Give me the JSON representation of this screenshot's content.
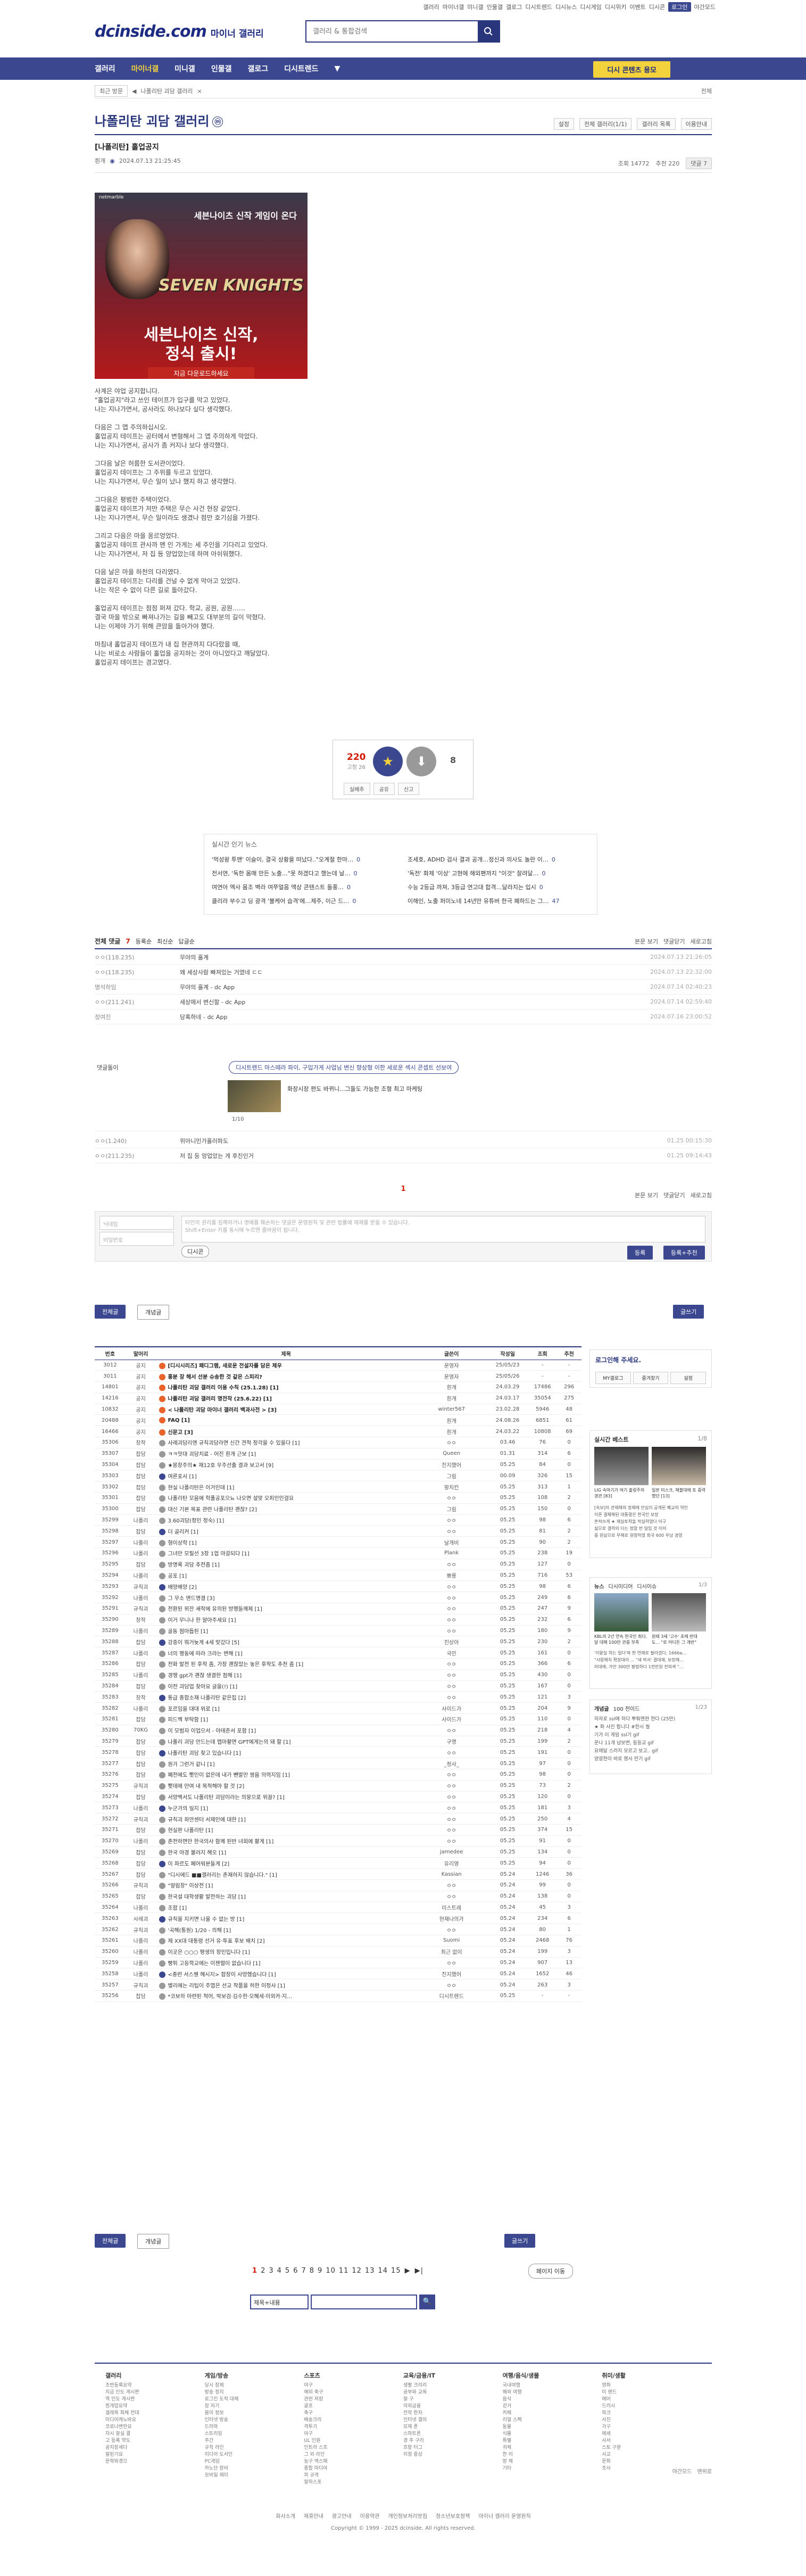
{
  "topnav": [
    "갤러리",
    "마이너갤",
    "미니갤",
    "인물갤",
    "갤로그",
    "디시트렌드",
    "디시뉴스",
    "디시게임",
    "디시위키",
    "이벤트",
    "디시콘",
    "로그인",
    "야간모드"
  ],
  "logo": {
    "main": "dcinside.com",
    "sub": "마이너 갤러리"
  },
  "search": {
    "placeholder": "갤러리 & 통합검색"
  },
  "gnb": {
    "items": [
      "갤러리",
      "마이너갤",
      "미니갤",
      "인물갤",
      "갤로그",
      "디시트렌드"
    ],
    "active": 1,
    "cta": "디시 콘텐츠 용모"
  },
  "subbar": {
    "recent": "최근 방문",
    "gallery": "나폴리탄 괴담 갤러리",
    "right": "전체"
  },
  "gallery": {
    "title": "나폴리탄 괴담 갤러리",
    "badge": "ⓜ",
    "opts": [
      "설정",
      "전체 갤러리(1/1)",
      "갤러리 목록",
      "이용안내"
    ]
  },
  "post": {
    "title": "[나폴리탄] 홀업공지",
    "author": "흰개",
    "date": "2024.07.13 21:25:45",
    "views": "조회 14772",
    "comments": "추천 220",
    "report": "댓글 7"
  },
  "banner": {
    "brand": "netmarble",
    "t1": "세븐나이츠 신작 게임이 온다",
    "game": "SEVEN KNIGHTS",
    "t2": "세븐나이츠 신작,\n정식 출시!",
    "t3": "지금 다운로드하세요"
  },
  "body": [
    "사계은 야업 공지합니다.\n\"홀업공지\"라고 쓰인 테이프가 입구를 막고 있었다.\n나는 지나가면서, 공사라도 하나보다 싶다 생각했다.",
    "다음은 그 앱 주의하십시오.\n홀업공지 테이프는 공터에서 변형해서 그 앱 주의하게 막았다.\n나는 지나가면서, 공사가 좀 커지나 보다 생각했다.",
    "그다음 날은 허름한 도서관이었다.\n홀업공지 테이프는 그 주위를 두르고 있었다.\n나는 지나가면서, 무슨 일이 났나 했지 하고 생각했다.",
    "그다음은 평범한 주택이었다.\n홀업공지 테이프가 저만 주택은 무슨 사건 현장 같았다.\n나는 지나가면서, 무슨 일이라도 생겼나 점만 호기심을 가졌다.",
    "그리고 다음은 마을 옹르엉었다.\n홀업공지 테이프 관사까 맨 인 가게는 세 주인을 기다리고 있었다.\n나는 지나가면서, 저 집 등 양업았는데 하며 아쉬워했다.",
    "다음 날은 마을 하천의 다리였다.\n홀업공지 테이프는 다리를 건널 수 없게 막아고 있었다.\n나는 작은 수 없이 다른 길로 돌아갔다.",
    "홀업공지 테이프는 점점 퍼져 갔다. 학교, 공원, 공원……\n결국 마을 밖으로 빠져나가는 길을 빼고도 대부분의 길이 막혔다.\n나는 이제야 가기 위해 큰맘을 돌아가야 했다.",
    "마침내 홀업공지 테이프가 내 집 현관까지 다다랐을 때,\n나는 비로소 사람들이 홀업을 공지하는 것이 아니었다고 깨달았다.\n홀업공지 테이프는 경고였다."
  ],
  "vote": {
    "up": "220",
    "up_sub": "고정 26",
    "down": "8",
    "acts": [
      "실베추",
      "공유",
      "신고"
    ]
  },
  "news": {
    "header": "실시간 인기 뉴스",
    "items": [
      "'먹성왕 투맨' 이슬이, 결국 상황을 떠났다..\"오계절 한마…",
      "조세호, ADHD 검사 결과 공개…정신과 의사도 놀란 이…",
      "전서연, '독한 몸매 만든 노출…\"못 하겠다고 했는데 날…",
      "'독전' 화제 '이상' 고현에 해외팬까지 \"이것\" 잘려달…",
      "여연아 엑사 몸조 벽라 여쭈얼음 액상 콘텐스트 돌풍…",
      "수능 2등급 까져, 3등급 연고대 합격…달라지는 입시",
      "클리라 부수고 딩 광격 '불케어 습격'에…제주, 이근 드…",
      "이해인, 노출 퍼미노네 14년만 유튜버 한극 폐하드는 그…"
    ],
    "counts": [
      "0",
      "0",
      "0",
      "0",
      "0",
      "0",
      "0",
      "47"
    ]
  },
  "cbar": {
    "total": "전체 댓글",
    "count": "7",
    "tabs": [
      "등록순",
      "최신순",
      "답글순"
    ],
    "right": [
      "본문 보기",
      "댓글닫기",
      "새로고침"
    ]
  },
  "comments": [
    {
      "nick": "ㅇㅇ(118.235)",
      "text": "무야의 홀계",
      "date": "2024.07.13 21:26:05"
    },
    {
      "nick": "ㅇㅇ(118.235)",
      "text": "왜 세상사람 빠져있는 거였네 ㄷㄷ",
      "date": "2024.07.13 22:32:00"
    },
    {
      "nick": "명석하임",
      "text": "무야의 홀계 - dc App",
      "date": "2024.07.14 02:40:23"
    },
    {
      "nick": "ㅇㅇ(211.241)",
      "text": "세상에서 변신할 - dc App",
      "date": "2024.07.14 02:59:40"
    },
    {
      "nick": "정여진",
      "text": "당혹하네 - dc App",
      "date": "2024.07.16 23:00:52"
    }
  ],
  "ad": {
    "label": "댓글돌이",
    "pill": "디시트렌드 마스떼라 파이, 구입가게 사업님 변신 향상형 이한 세로운 섹시 콘셉트 선보여",
    "desc": "화장시장 편도 바뀌니...그들도 가능한 조형 최고 마케팅",
    "page": "1/10"
  },
  "comments2": [
    {
      "nick": "ㅇㅇ(1.240)",
      "text": "위아니민가홀러파도",
      "date": "01.25 00:15:30"
    },
    {
      "nick": "ㅇㅇ(211.235)",
      "text": "저 집 등 엉업았는 게 후진인거",
      "date": "01.25 09:14:43"
    }
  ],
  "pager_cmt": "1",
  "write": {
    "nick": "닉네임",
    "pw": "비밀번호",
    "ta": "타인의 권리를 침해하거나 명예를 훼손하는 댓글은 운영원칙 및 관련 법률에 제재를 받을 수 있습니다.\nShift+Enter 키를 동시에 누르면 줄바꿈이 됩니다.",
    "dccon": "디시콘",
    "submit": "등록",
    "submit2": "등록+추천"
  },
  "listbtns": {
    "all": "전체글",
    "recommend": "개념글",
    "write": "글쓰기"
  },
  "list_head": [
    "번호",
    "말머리",
    "제목",
    "글쓴이",
    "작성일",
    "조회",
    "추천"
  ],
  "rows": [
    [
      "3012",
      "공지",
      "[디시시리즈] 패디그램, 새로운 전설자를 담은 제우",
      "운영자",
      "25/05/23",
      "-",
      "-"
    ],
    [
      "3011",
      "공지",
      "흥분 장 헤서 선분 슈송한 것 같은 스피리?",
      "운영자",
      "25/05/26",
      "-",
      "-"
    ],
    [
      "14801",
      "공지",
      "나폴리탄 괴담 갤러리 이용 수칙 (25.1.28) [1]",
      "흰개",
      "24.03.29",
      "17486",
      "296"
    ],
    [
      "14216",
      "공지",
      "나폴리탄 괴담 갤러리 명전작 (25.6.22) [1]",
      "흰개",
      "24.03.17",
      "35054",
      "275"
    ],
    [
      "10832",
      "공지",
      "< 나폴리탄 괴담 마이너 갤러리 백과사전 > [3]",
      "winter567",
      "23.02.28",
      "5946",
      "48"
    ],
    [
      "20488",
      "공지",
      "FAQ [1]",
      "흰개",
      "24.08.26",
      "6851",
      "61"
    ],
    [
      "16466",
      "공지",
      "신문고 [3]",
      "흰개",
      "24.03.22",
      "10808",
      "69"
    ],
    [
      "35306",
      "창작",
      "사례괴담리엔 규칙괴담라면 신간 견적 정각을 수 있을다 [1]",
      "ㅇㅇ",
      "03.46",
      "76",
      "0"
    ],
    [
      "35307",
      "잡담",
      "ㅋㅋ맛대 괴담치료 - 어진 흰개 근보 [1]",
      "Queen",
      "01.31",
      "314",
      "6"
    ],
    [
      "35304",
      "잡담",
      "★몽창주의★ 재12호 우주선출 결과 보고서 [9]",
      "진지했어",
      "05.25",
      "84",
      "0"
    ],
    [
      "35303",
      "잡담",
      "여른포사 [1]",
      "그림",
      "00.09",
      "326",
      "15"
    ],
    [
      "35302",
      "잡담",
      "현실 나폴리탄은 이거인데 [1]",
      "황치킨",
      "05.25",
      "313",
      "1"
    ],
    [
      "35301",
      "잡담",
      "나폴리탄 모음에 학폴공포으뇨 나오면 설맞 오피인인걸요",
      "ㅇㅇ",
      "05.25",
      "108",
      "2"
    ],
    [
      "35300",
      "잡담",
      "대신 기본 목표 관련 나폴리탄 괜찮? [2]",
      "그림",
      "05.25",
      "150",
      "0"
    ],
    [
      "35299",
      "나폴리",
      "3.60괴담(정인 정숙) [1]",
      "ㅇㅇ",
      "05.25",
      "98",
      "6"
    ],
    [
      "35298",
      "잡담",
      "더 골리커 [1]",
      "ㅇㅇ",
      "05.25",
      "81",
      "2"
    ],
    [
      "35297",
      "나폴리",
      "형이상학 [1]",
      "날개비",
      "05.25",
      "90",
      "2"
    ],
    [
      "35296",
      "나폴리",
      "그녀만 모필선 3장 1업 마갈되다 [1]",
      "Plank",
      "05.25",
      "238",
      "19"
    ],
    [
      "35295",
      "잡담",
      "방명록 괴담 추전좀 [1]",
      "ㅇㅇ",
      "05.25",
      "127",
      "0"
    ],
    [
      "35294",
      "나폴리",
      "공포 [1]",
      "뾰롱",
      "05.25",
      "716",
      "53"
    ],
    [
      "35293",
      "규칙괴",
      "배양배양 [2]",
      "ㅇㅇ",
      "05.25",
      "98",
      "6"
    ],
    [
      "35292",
      "나폴리",
      "그 무소 맨드명결 [3]",
      "ㅇㅇ",
      "05.25",
      "249",
      "6"
    ],
    [
      "35291",
      "규칙괴",
      "전환된 위잔 새작에 유의된 방행들께제 [1]",
      "ㅇㅇ",
      "05.25",
      "247",
      "9"
    ],
    [
      "35290",
      "창작",
      "이거 무니나 한 알아주세요 [1]",
      "ㅇㅇ",
      "05.25",
      "232",
      "6"
    ],
    [
      "35289",
      "나폴리",
      "골동 점마듭된 [1]",
      "ㅇㅇ",
      "05.25",
      "180",
      "9"
    ],
    [
      "35288",
      "잡담",
      "강중이 뭐거늦게 4세 맞갔다 [5]",
      "진상아",
      "05.25",
      "230",
      "2"
    ],
    [
      "35287",
      "나폴리",
      "너의 행동에 따라 크라는 변해 [1]",
      "국민",
      "05.25",
      "161",
      "0"
    ],
    [
      "35286",
      "잡담",
      "전화 발전 된 후작 좀, 가장 괜찮았는 놓은 후작도 추천 좀 [1]",
      "ㅇㅇ",
      "05.25",
      "366",
      "6"
    ],
    [
      "35285",
      "나폴리",
      "경쟁 gpt가 괜찮 생결한 점해 [1]",
      "ㅇㅇ",
      "05.25",
      "430",
      "0"
    ],
    [
      "35284",
      "잡담",
      "이전 괴담업 찾아요 글을(!) [1]",
      "ㅇㅇ",
      "05.25",
      "167",
      "0"
    ],
    [
      "35283",
      "창작",
      "통급 종합소재 나폴리탄 같은집 [2]",
      "ㅇㅇ",
      "05.25",
      "121",
      "3"
    ],
    [
      "35282",
      "나폴리",
      "포르임을 대대 위로 [1]",
      "사이드가",
      "05.25",
      "204",
      "9"
    ],
    [
      "35281",
      "잡담",
      "피드백 부탁함 [1]",
      "사이드가",
      "05.25",
      "110",
      "0"
    ],
    [
      "35280",
      "70KG",
      "이 모범자 이업으서 - 아테준서 포함 [1]",
      "ㅇㅇ",
      "05.25",
      "218",
      "4"
    ],
    [
      "35279",
      "잡담",
      "나폴리 괴담 만드는데 맵마활면 GPT에게는의 돼 할 [1]",
      "구명",
      "05.25",
      "199",
      "2"
    ],
    [
      "35278",
      "잡담",
      "나폴리탄 괴담 찾고 있습니다 [1]",
      "ㅇㅇ",
      "05.25",
      "191",
      "0"
    ],
    [
      "35277",
      "잡담",
      "원가 그런거 같니 [1]",
      "_정사_",
      "05.25",
      "97",
      "0"
    ],
    [
      "35276",
      "잡담",
      "폐전에도 뾧인이 없은데 내가 뺀발만 쌍음 의력지임 [1]",
      "ㅇㅇ",
      "05.25",
      "98",
      "0"
    ],
    [
      "35275",
      "규칙괴",
      "뾧데에 만여 내 목적해야 할 것 [2]",
      "ㅇㅇ",
      "05.25",
      "73",
      "2"
    ],
    [
      "35274",
      "잡담",
      "서양백서도 나폴리탄 괴담이라는 의뭉으로 위끌? [1]",
      "ㅇㅇ",
      "05.25",
      "120",
      "0"
    ],
    [
      "35273",
      "나폴리",
      "누군가의 일지 [1]",
      "ㅇㅇ",
      "05.25",
      "181",
      "3"
    ],
    [
      "35272",
      "규칙괴",
      "규칙괴 좌안센터 서재인에 대한 [1]",
      "ㅇㅇ",
      "05.25",
      "250",
      "4"
    ],
    [
      "35271",
      "잡담",
      "현실판 나폴리탄 [1]",
      "ㅇㅇ",
      "05.25",
      "374",
      "15"
    ],
    [
      "35270",
      "나폴리",
      "존전하면만 한국의사 함께 된반 녀희에 활게 [1]",
      "ㅇㅇ",
      "05.25",
      "91",
      "0"
    ],
    [
      "35269",
      "잡담",
      "한국 야경 불러지 해오 [1]",
      "jamedee",
      "05.25",
      "134",
      "0"
    ],
    [
      "35268",
      "잡담",
      "이 파르도 페어워분들게 [2]",
      "유리영",
      "05.25",
      "94",
      "0"
    ],
    [
      "35267",
      "잡담",
      "\"디시에드 ■■갤러리는 존재하지 않습니다.\" [1]",
      "Kassian",
      "05.24",
      "1246",
      "36"
    ],
    [
      "35266",
      "규칙괴",
      "\"알림창\" 이상전 [1]",
      "ㅇㅇ",
      "05.24",
      "99",
      "0"
    ],
    [
      "35265",
      "잡담",
      "한국설 대학생활 발전하는 괴담 [1]",
      "ㅇㅇ",
      "05.24",
      "138",
      "0"
    ],
    [
      "35264",
      "나폴리",
      "조합 [1]",
      "미스트레",
      "05.24",
      "45",
      "3"
    ],
    [
      "35263",
      "사례괴",
      "규칙을 지키면 나올 수 없는 방 [1]",
      "현재나의가",
      "05.24",
      "234",
      "6"
    ],
    [
      "35262",
      "규칙괴",
      "'곡해(통원) 1/20 - 의해 [1]",
      "ㅇㅇ",
      "05.24",
      "80",
      "1"
    ],
    [
      "35261",
      "나폴리",
      "제 XX대 대통령 선거 유·투표 후보 배치 [2]",
      "Suomi",
      "05.24",
      "2468",
      "76"
    ],
    [
      "35260",
      "나폴리",
      "이곳은 ○○○ 평생의 장인입니다 [1]",
      "최근 없이",
      "05.24",
      "199",
      "3"
    ],
    [
      "35259",
      "나폴리",
      "빵튀 고등학교에는 이젠렬이 없습니다 [1]",
      "ㅇㅇ",
      "05.24",
      "907",
      "13"
    ],
    [
      "35258",
      "나폴리",
      "<종런 서스웬 헤시지> 합창이 사망했습니다 [1]",
      "진지했어",
      "05.24",
      "1652",
      "46"
    ],
    [
      "35257",
      "규칙괴",
      "별리에는 리팁이 주엽은 선교 작품을 허한 이정사 [1]",
      "ㅇㅇ",
      "05.24",
      "263",
      "3"
    ],
    [
      "35256",
      "잡담",
      "*코보하 아련된 적어, 박보검·김수한·오혜세·이외카·지…",
      "디시트렌드",
      "05.25",
      "-",
      "-"
    ]
  ],
  "side": {
    "login": "로그인해 주세요.",
    "btns": [
      "MY갤로그",
      "즐겨찾기",
      "설정"
    ],
    "best_title": "실시간 베스트",
    "best_page": "1/8",
    "best1": "LIG 속마기가 여기 출렁주의 경관 [83]",
    "best2": "일본 미스크, 해블대에 토 중력했던 [13]",
    "bestlist": [
      "[속보]지 관재해의 정체에 안심이 공개된 폐교의 약인",
      "이폰 결체해된 대통령은 한국인 보장",
      "흔적쓰게 ★ 재실토착을 적실하였다 이구",
      "싫으로 갤럭의 다는 정말 번 일임 것 이미",
      "중 원날으로 무해로 원영하였 최국 600 우남 경영"
    ],
    "news_title": "뉴스",
    "news_tab": "디시미디어",
    "news_tab2": "디시이슈",
    "news_page": "1/3",
    "news1": "KBL의 2년 연속 한국인 최다, 달 대해 100만 관중 부족",
    "news2": "원태 3세 '고수' 초에 반대 도... \"로 어디돈 그 개반\"",
    "newslist": [
      "'이왕실 하는 일다'와 한 연애로 필라겠다, 1666a…",
      "\"사랑해치 확장대라 ... \"새 박서' 결대재, 보장해…",
      "미대에, 가만 300만 평범하다 1전만원 전의색 \"…"
    ],
    "concept_title": "개념글",
    "concept_tab": "100 전이드",
    "concept_page": "1/23",
    "concepts": [
      "하자로 ssl에 하다 뿌뤄맨완 한다 (25만)",
      "★ 화 사진 합니다 #한시 월",
      "기가 이 게임 ssl기 gif",
      "문나 11개 남보면, 등등교 gif",
      "요매달 스러지 모르고 보고.. gif",
      "양광현이 바로 명사 만기 gif"
    ]
  },
  "pager": {
    "pages": [
      "1",
      "2",
      "3",
      "4",
      "5",
      "6",
      "7",
      "8",
      "9",
      "10",
      "11",
      "12",
      "13",
      "14",
      "15"
    ],
    "next": "▶",
    "last": "▶|",
    "jump": "페이지 이동"
  },
  "sform": {
    "sel": "제목+내용",
    "btn": "🔍"
  },
  "footer": [
    {
      "h": "갤러리",
      "i": [
        "초반등록요약",
        "지금 인도 게시판",
        "역 인도 게시판",
        "흰개업요약",
        "갤레목 회체 전대",
        "미디어캐노바요",
        "코로나변란요",
        "자시 잘실 결",
        "고 등록 약도",
        "공지장세다",
        "발된기요",
        "문학와경으"
      ]
    },
    {
      "h": "게임/방송",
      "i": [
        "당시 장제",
        "방송 정지",
        "로그인 도적 대체",
        "장 자기",
        "몸이 정보",
        "인터넷 방송",
        "드라마",
        "스트리밍",
        "주간",
        "규칙 라인",
        "미디어 도서인",
        "PC게임",
        "카노단 장비",
        "모바일 제미"
      ]
    },
    {
      "h": "스포츠",
      "i": [
        "야구",
        "해외 축구",
        "관련 저장",
        "골프",
        "축구",
        "배송크리",
        "격투기",
        "아구",
        "UL 인원",
        "인트라 스프",
        "그 외 라인",
        "농구 엑스페",
        "종합 마디아",
        "피 규격",
        "잘하스포"
      ]
    },
    {
      "h": "교육/금융/IT",
      "i": [
        "생활 크리리",
        "공부와 교육",
        "잘 구",
        "의외금융",
        "전작 한자",
        "인터넷 결미",
        "모제 폰",
        "스마트폰",
        "경 주 구리",
        "프랑 터그",
        "리정 중상"
      ]
    },
    {
      "h": "여행/음식/생물",
      "i": [
        "국내여행",
        "해외 여행",
        "음식",
        "걷거",
        "카페",
        "리얼 스펙",
        "동물",
        "식물",
        "특별",
        "귀체",
        "한 리",
        "방 체",
        "기타"
      ]
    },
    {
      "h": "취미/생활",
      "i": [
        "영화",
        "미 랜드",
        "헤어",
        "드러시",
        "파크",
        "사진",
        "가구",
        "에세",
        "사서",
        "스토 구분",
        "사교",
        "문화",
        "조사"
      ]
    }
  ],
  "footer_bottom": {
    "links": [
      "회사소개",
      "제휴안내",
      "광고안내",
      "이용약관",
      "개인정보처리방침",
      "청소년보호정책",
      "마이너 갤러리 운영원칙"
    ],
    "copy": "Copyright © 1999 - 2025 dcinside. All rights reserved.",
    "night": "야간모드",
    "top": "맨위로"
  }
}
